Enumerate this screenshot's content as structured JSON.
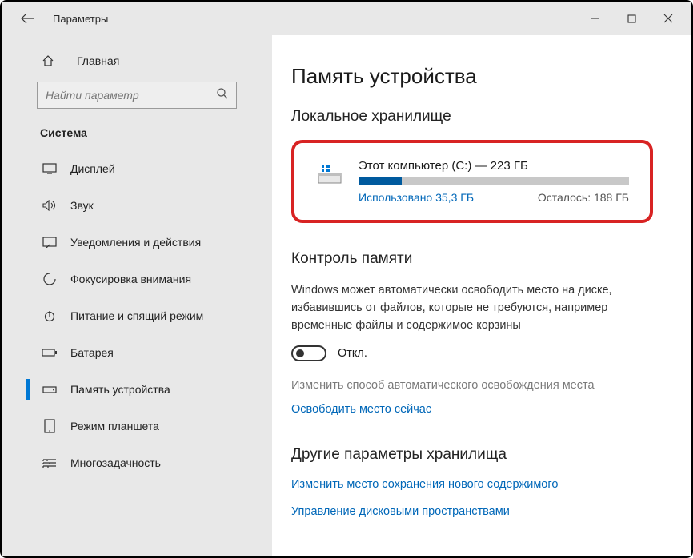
{
  "window": {
    "title": "Параметры"
  },
  "sidebar": {
    "home": "Главная",
    "search_placeholder": "Найти параметр",
    "subhead": "Система",
    "items": [
      {
        "label": "Дисплей"
      },
      {
        "label": "Звук"
      },
      {
        "label": "Уведомления и действия"
      },
      {
        "label": "Фокусировка внимания"
      },
      {
        "label": "Питание и спящий режим"
      },
      {
        "label": "Батарея"
      },
      {
        "label": "Память устройства"
      },
      {
        "label": "Режим планшета"
      },
      {
        "label": "Многозадачность"
      }
    ]
  },
  "main": {
    "title": "Память устройства",
    "local_heading": "Локальное хранилище",
    "disk": {
      "title": "Этот компьютер (C:) — 223 ГБ",
      "used": "Использовано 35,3 ГБ",
      "remaining": "Осталось: 188 ГБ",
      "fill_pct": 16
    },
    "sense": {
      "heading": "Контроль памяти",
      "desc": "Windows может автоматически освободить место на диске, избавившись от файлов, которые не требуются, например временные файлы и содержимое корзины",
      "toggle_label": "Откл.",
      "change_label": "Изменить способ автоматического освобождения места",
      "free_now": "Освободить место сейчас"
    },
    "other": {
      "heading": "Другие параметры хранилища",
      "change_save": "Изменить место сохранения нового содержимого",
      "manage_spaces": "Управление дисковыми пространствами"
    }
  }
}
